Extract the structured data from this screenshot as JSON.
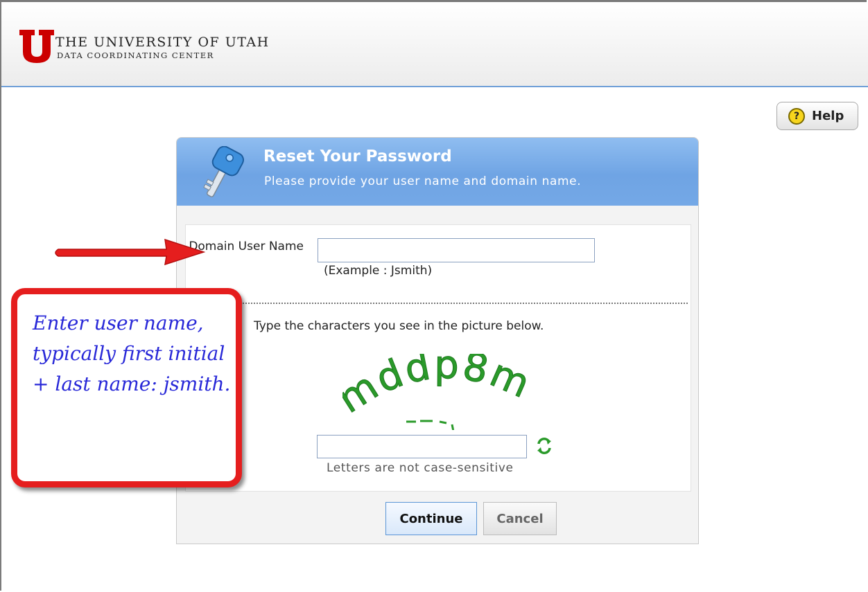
{
  "header": {
    "logo_line1": "THE UNIVERSITY OF UTAH",
    "logo_line2": "DATA COORDINATING CENTER",
    "logo_color": "#cc0000"
  },
  "help": {
    "icon_glyph": "?",
    "label": "Help"
  },
  "dialog": {
    "title": "Reset Your Password",
    "subtitle": "Please provide your user name and domain name.",
    "header_color": "#76a9e6",
    "username_label": "Domain User Name",
    "username_value": "",
    "username_example": "(Example : Jsmith)",
    "captcha_instruction": "Type the characters you see in the picture below.",
    "captcha_text": "mddp8m",
    "captcha_value": "",
    "captcha_note": "Letters are not case-sensitive",
    "continue_label": "Continue",
    "cancel_label": "Cancel"
  },
  "annotation": {
    "callout_text": "Enter user name, typically first initial + last name: jsmith.",
    "callout_color": "#e51e1e",
    "text_color": "#2828d8"
  },
  "icons": {
    "logo": "university-u-logo-icon",
    "help": "question-mark-icon",
    "dialog": "key-icon",
    "refresh": "refresh-icon",
    "arrow": "red-arrow-icon"
  }
}
